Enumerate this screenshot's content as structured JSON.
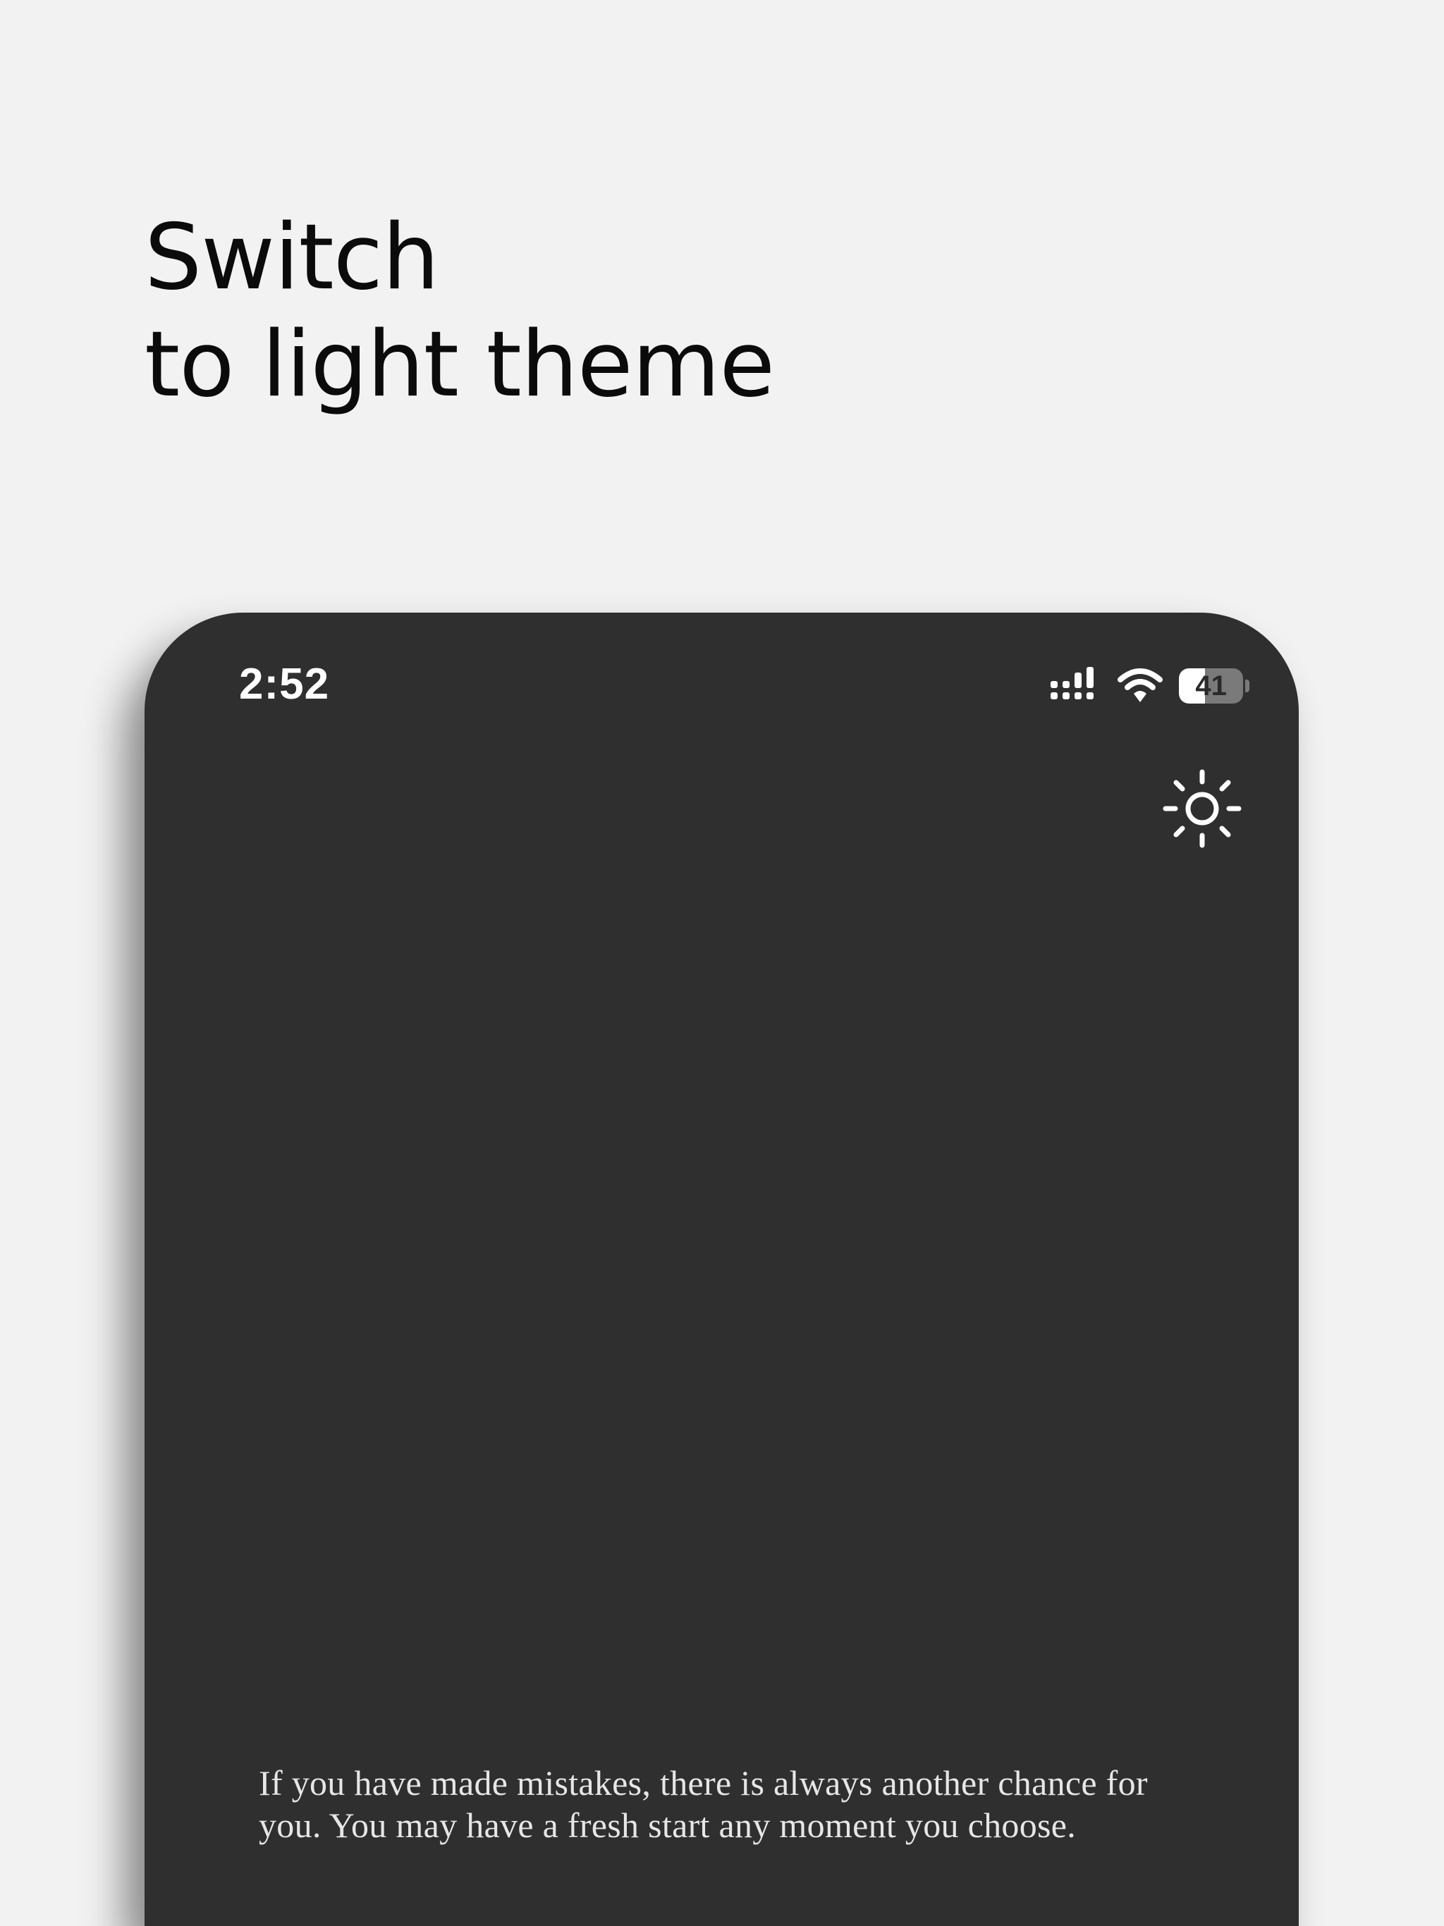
{
  "headline": {
    "line1": "Switch",
    "line2": "to light theme"
  },
  "status_bar": {
    "time": "2:52",
    "battery_level": "41",
    "battery_fraction": 0.41,
    "icons": [
      "cellular-signal-icon",
      "wifi-icon",
      "battery-icon"
    ]
  },
  "theme_toggle": {
    "icon": "sun-icon"
  },
  "quote": {
    "text": "If you have made mistakes, there is always another chance for you. You may have a fresh start any moment you choose."
  },
  "colors": {
    "page_background": "#f2f2f2",
    "screen_background": "#2f2f2f",
    "headline_text": "#0b0b0b",
    "screen_text": "#e6e6e6"
  }
}
